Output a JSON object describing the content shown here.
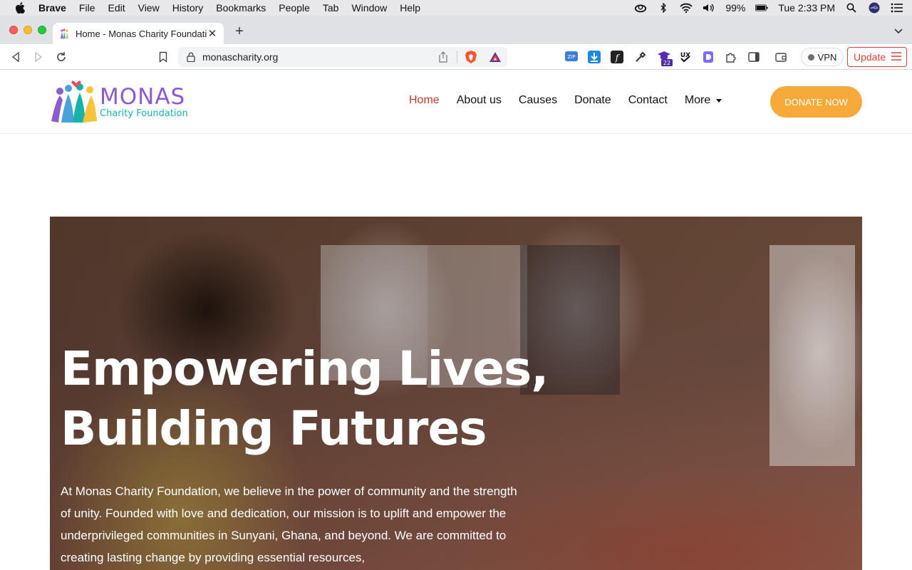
{
  "menubar": {
    "app": "Brave",
    "items": [
      "File",
      "Edit",
      "View",
      "History",
      "Bookmarks",
      "People",
      "Tab",
      "Window",
      "Help"
    ],
    "battery": "99%",
    "clock": "Tue 2:33 PM"
  },
  "browser": {
    "tab_title": "Home - Monas Charity Foundation",
    "url": "monascharity.org",
    "vpn_label": "VPN",
    "update_label": "Update",
    "extension_badge": "22"
  },
  "site": {
    "logo_name": "MONAS",
    "logo_tagline": "Charity Foundation",
    "nav": [
      "Home",
      "About us",
      "Causes",
      "Donate",
      "Contact",
      "More"
    ],
    "donate_button": "DONATE NOW",
    "hero_title": "Empowering Lives, Building Futures",
    "hero_body": "At Monas Charity Foundation, we believe in the power of community and the strength of unity. Founded with love and dedication, our mission is to uplift and empower the underprivileged communities in Sunyani, Ghana, and beyond. We are committed to creating lasting change by providing essential resources,"
  },
  "colors": {
    "nav_active": "#c0392b",
    "donate_bg": "#f7aa3a",
    "logo_purple": "#8c5ad1",
    "logo_teal": "#16b3a8"
  }
}
